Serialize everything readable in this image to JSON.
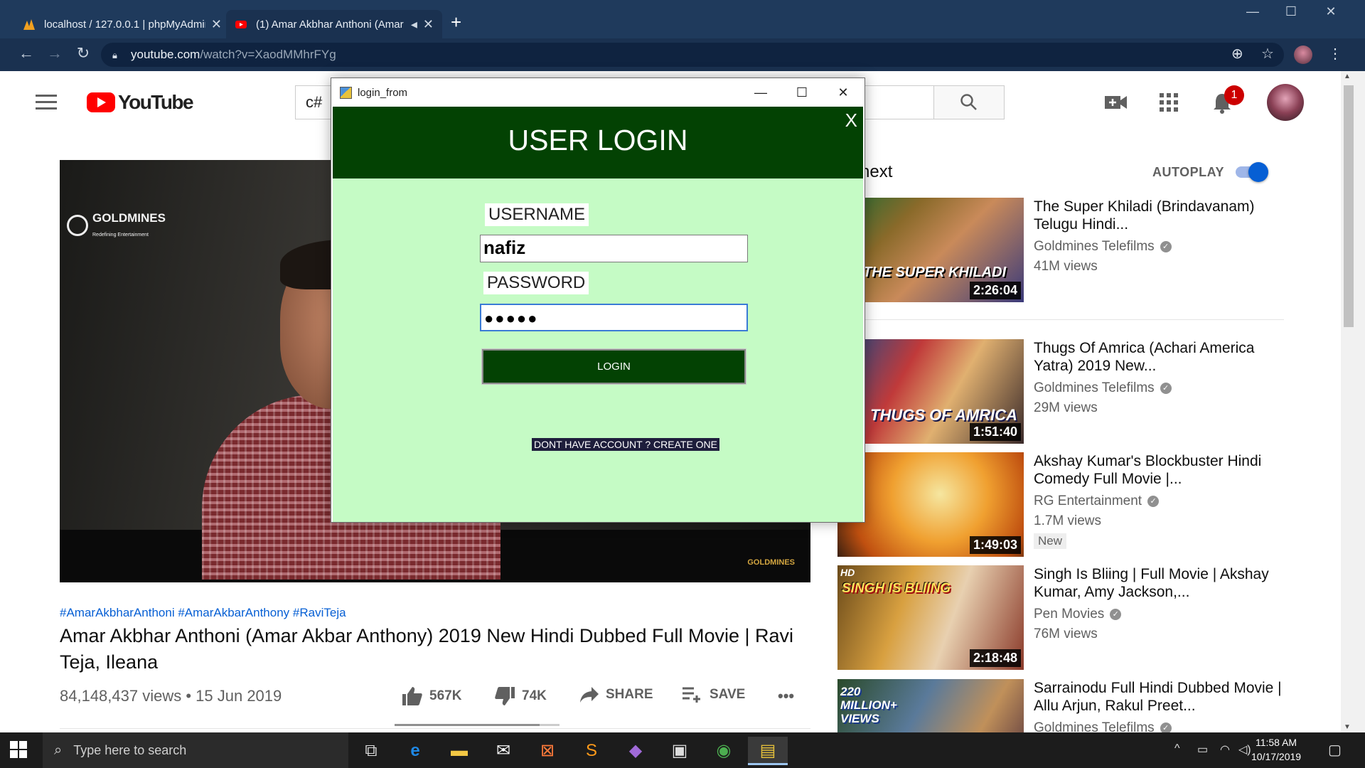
{
  "browser": {
    "tabs": [
      {
        "title": "localhost / 127.0.0.1 | phpMyAdmin",
        "favicon": "phpmyadmin-icon"
      },
      {
        "title": "(1) Amar Akbhar Anthoni (Amar Akbar Anthony)",
        "favicon": "youtube-icon"
      }
    ],
    "url_host": "youtube.com",
    "url_path": "/watch?v=XaodMMhrFYg"
  },
  "youtube": {
    "logo_text": "YouTube",
    "search_value": "c#",
    "notification_count": "1",
    "video": {
      "watermark_top": "GOLDMINES",
      "watermark_top_sub": "Redefining Entertainment",
      "watermark_bottom": "GOLDMINES",
      "hashtags": "#AmarAkbharAnthoni #AmarAkbarAnthony #RaviTeja",
      "title": "Amar Akbhar Anthoni (Amar Akbar Anthony) 2019 New Hindi Dubbed Full Movie | Ravi Teja, Ileana",
      "views_date": "84,148,437 views • 15 Jun 2019",
      "likes": "567K",
      "dislikes": "74K",
      "share_label": "SHARE",
      "save_label": "SAVE",
      "more_label": "•••",
      "like_ratio": 0.88
    },
    "up_next_label": "next",
    "autoplay_label": "AUTOPLAY",
    "recommendations": [
      {
        "title": "The Super Khiladi (Brindavanam) Telugu Hindi...",
        "channel": "Goldmines Telefilms",
        "views": "41M views",
        "duration": "2:26:04",
        "thumb_text": "THE SUPER KHILADI",
        "verified": true
      },
      {
        "title": "Thugs Of Amrica (Achari America Yatra) 2019 New...",
        "channel": "Goldmines Telefilms",
        "views": "29M views",
        "duration": "1:51:40",
        "thumb_text": "THUGS OF AMRICA",
        "verified": true
      },
      {
        "title": "Akshay Kumar's Blockbuster Hindi Comedy Full Movie |...",
        "channel": "RG Entertainment",
        "views": "1.7M views",
        "duration": "1:49:03",
        "badge": "New",
        "verified": true
      },
      {
        "title": "Singh Is Bliing | Full Movie | Akshay Kumar, Amy Jackson,...",
        "channel": "Pen Movies",
        "views": "76M views",
        "duration": "2:18:48",
        "thumb_text": "SINGH IS BLIING",
        "hd": "HD",
        "verified": true
      },
      {
        "title": "Sarrainodu Full Hindi Dubbed Movie | Allu Arjun, Rakul Preet...",
        "channel": "Goldmines Telefilms",
        "thumb_text": "220 MILLION+ VIEWS",
        "verified": true
      }
    ]
  },
  "login_dialog": {
    "window_title": "login_from",
    "heading": "USER LOGIN",
    "close_label": "X",
    "username_label": "USERNAME",
    "username_value": "nafiz",
    "password_label": "PASSWORD",
    "password_value": "●●●●●",
    "login_button": "LOGIN",
    "create_account_link": "DONT HAVE ACCOUNT ? CREATE ONE"
  },
  "taskbar": {
    "search_placeholder": "Type here to search",
    "time": "11:58 AM",
    "date": "10/17/2019"
  }
}
